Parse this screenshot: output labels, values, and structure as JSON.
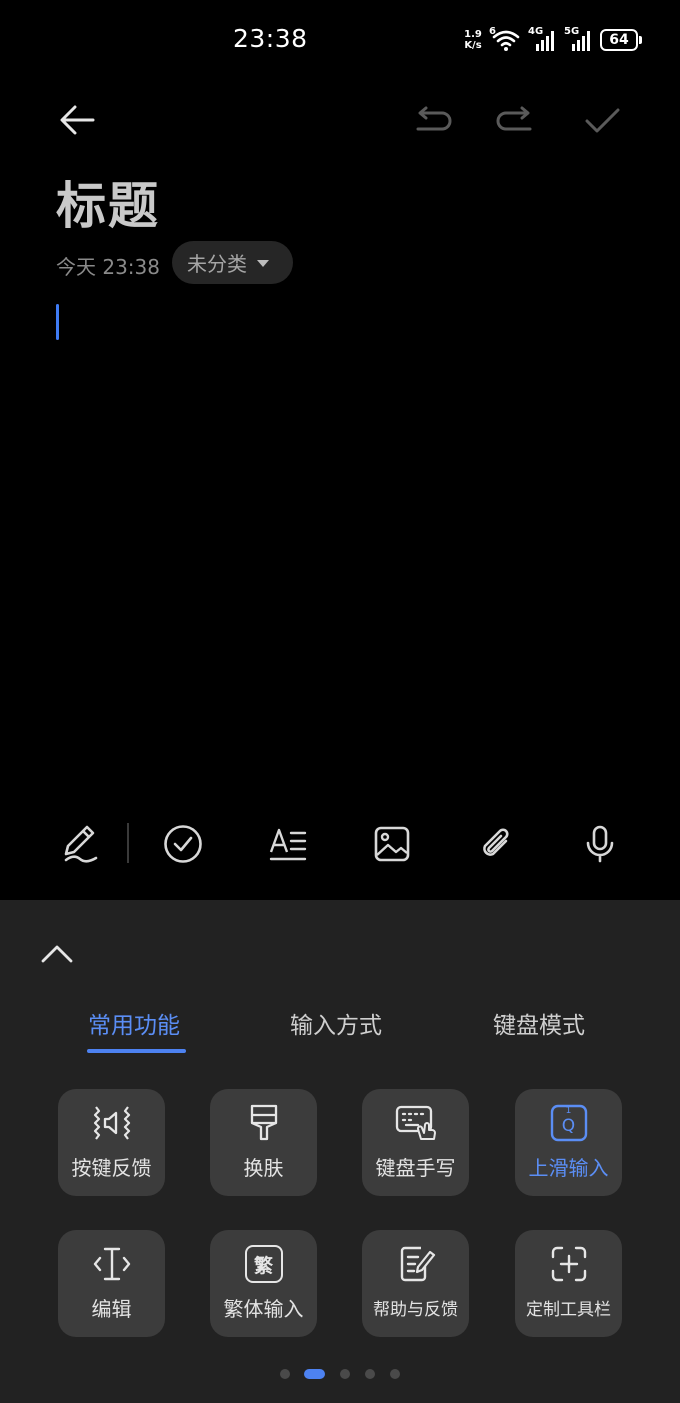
{
  "status": {
    "time": "23:38",
    "net_speed_value": "1.9",
    "net_speed_unit": "K/s",
    "wifi_badge": "6",
    "sim1_label": "4G",
    "sim2_label": "5G",
    "battery": "64"
  },
  "note": {
    "title_placeholder": "标题",
    "date": "今天 23:38",
    "category": "未分类"
  },
  "keyboard_panel": {
    "tabs": [
      {
        "label": "常用功能"
      },
      {
        "label": "输入方式"
      },
      {
        "label": "键盘模式"
      }
    ],
    "tiles": [
      {
        "label": "按键反馈"
      },
      {
        "label": "换肤"
      },
      {
        "label": "键盘手写"
      },
      {
        "label": "上滑输入"
      },
      {
        "label": "编辑"
      },
      {
        "label": "繁体输入"
      },
      {
        "label": "帮助与反馈"
      },
      {
        "label": "定制工具栏"
      }
    ],
    "fan_glyph": "繁",
    "swipe_key_glyph": "Q",
    "swipe_key_sup": "1"
  },
  "colors": {
    "accent": "#4d82f1",
    "background": "#000000",
    "panel": "#222222",
    "tile": "#3c3c3c"
  }
}
